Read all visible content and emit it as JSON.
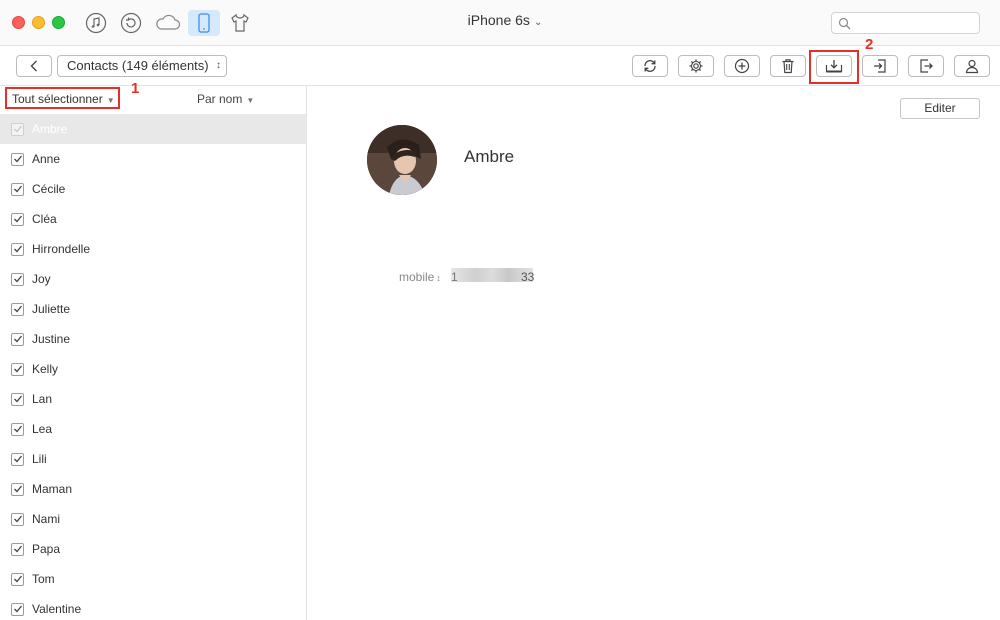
{
  "titlebar": {
    "device_title": "iPhone 6s",
    "top_icons": [
      "music-note-icon",
      "restore-icon",
      "cloud-icon",
      "iphone-icon",
      "tshirt-icon"
    ],
    "search_placeholder": ""
  },
  "toolbar": {
    "contacts_select": "Contacts (149 éléments)",
    "buttons": [
      "refresh-icon",
      "settings-icon",
      "add-icon",
      "trash-icon",
      "export-to-computer-icon",
      "import-icon",
      "export-icon",
      "contact-icon"
    ]
  },
  "annotations": {
    "step1": "1",
    "step2": "2",
    "highlight_color": "#e5302a"
  },
  "list": {
    "select_all": "Tout sélectionner",
    "sort": "Par nom",
    "contacts": [
      {
        "name": "Ambre",
        "checked": true,
        "selected": true
      },
      {
        "name": "Anne",
        "checked": true
      },
      {
        "name": "Cécile",
        "checked": true
      },
      {
        "name": "Cléa",
        "checked": true
      },
      {
        "name": "Hirrondelle",
        "checked": true
      },
      {
        "name": "Joy",
        "checked": true
      },
      {
        "name": "Juliette",
        "checked": true
      },
      {
        "name": "Justine",
        "checked": true
      },
      {
        "name": "Kelly",
        "checked": true
      },
      {
        "name": "Lan",
        "checked": true
      },
      {
        "name": "Lea",
        "checked": true
      },
      {
        "name": "Lili",
        "checked": true
      },
      {
        "name": "Maman",
        "checked": true
      },
      {
        "name": "Nami",
        "checked": true
      },
      {
        "name": "Papa",
        "checked": true
      },
      {
        "name": "Tom",
        "checked": true
      },
      {
        "name": "Valentine",
        "checked": true
      }
    ]
  },
  "detail": {
    "edit_label": "Editer",
    "name": "Ambre",
    "phone_label": "mobile",
    "phone_prefix": "1",
    "phone_suffix": "33"
  },
  "colors": {
    "accent_active": "#d4e9fb",
    "selected_row": "#e8e8e8"
  }
}
